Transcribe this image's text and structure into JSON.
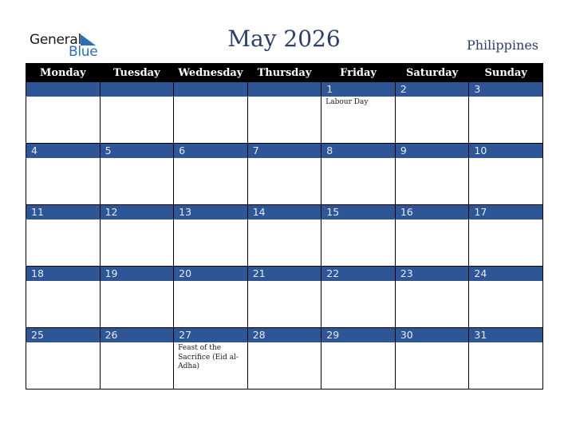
{
  "logo": {
    "word1": "General",
    "word2": "Blue"
  },
  "header": {
    "title": "May 2026",
    "country": "Philippines"
  },
  "colors": {
    "band": "#2e5596",
    "header_bg": "#000000",
    "title": "#2b3f6b",
    "logo_blue": "#2c6fb5"
  },
  "weekdays": [
    "Monday",
    "Tuesday",
    "Wednesday",
    "Thursday",
    "Friday",
    "Saturday",
    "Sunday"
  ],
  "weeks": [
    [
      {
        "day": "",
        "event": ""
      },
      {
        "day": "",
        "event": ""
      },
      {
        "day": "",
        "event": ""
      },
      {
        "day": "",
        "event": ""
      },
      {
        "day": "1",
        "event": "Labour Day"
      },
      {
        "day": "2",
        "event": ""
      },
      {
        "day": "3",
        "event": ""
      }
    ],
    [
      {
        "day": "4",
        "event": ""
      },
      {
        "day": "5",
        "event": ""
      },
      {
        "day": "6",
        "event": ""
      },
      {
        "day": "7",
        "event": ""
      },
      {
        "day": "8",
        "event": ""
      },
      {
        "day": "9",
        "event": ""
      },
      {
        "day": "10",
        "event": ""
      }
    ],
    [
      {
        "day": "11",
        "event": ""
      },
      {
        "day": "12",
        "event": ""
      },
      {
        "day": "13",
        "event": ""
      },
      {
        "day": "14",
        "event": ""
      },
      {
        "day": "15",
        "event": ""
      },
      {
        "day": "16",
        "event": ""
      },
      {
        "day": "17",
        "event": ""
      }
    ],
    [
      {
        "day": "18",
        "event": ""
      },
      {
        "day": "19",
        "event": ""
      },
      {
        "day": "20",
        "event": ""
      },
      {
        "day": "21",
        "event": ""
      },
      {
        "day": "22",
        "event": ""
      },
      {
        "day": "23",
        "event": ""
      },
      {
        "day": "24",
        "event": ""
      }
    ],
    [
      {
        "day": "25",
        "event": ""
      },
      {
        "day": "26",
        "event": ""
      },
      {
        "day": "27",
        "event": "Feast of the Sacrifice (Eid al-Adha)"
      },
      {
        "day": "28",
        "event": ""
      },
      {
        "day": "29",
        "event": ""
      },
      {
        "day": "30",
        "event": ""
      },
      {
        "day": "31",
        "event": ""
      }
    ]
  ]
}
